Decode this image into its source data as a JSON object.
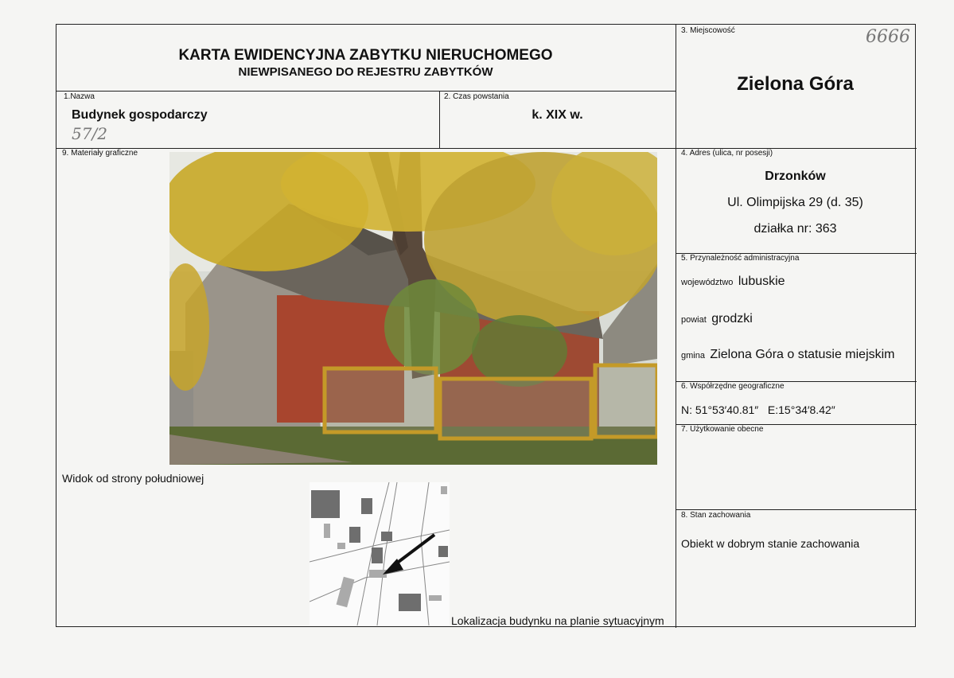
{
  "header": {
    "title_line1": "KARTA EWIDENCYJNA ZABYTKU NIERUCHOMEGO",
    "title_line2": "NIEWPISANEGO DO REJESTRU ZABYTKÓW"
  },
  "handwritten": {
    "card_number": "6666",
    "name_note": "57/2"
  },
  "fields": {
    "nazwa": {
      "label": "1.Nazwa",
      "value": "Budynek gospodarczy"
    },
    "czas": {
      "label": "2. Czas powstania",
      "value": "k. XIX w."
    },
    "miejscowosc": {
      "label": "3. Miejscowość",
      "value": "Zielona Góra"
    },
    "adres": {
      "label": "4. Adres (ulica, nr posesji)",
      "line1": "Drzonków",
      "line2": "Ul. Olimpijska 29 (d. 35)",
      "line3": "działka nr: 363"
    },
    "przynaleznosc": {
      "label": "5. Przynależność administracyjna",
      "woj_label": "województwo",
      "woj_value": "lubuskie",
      "powiat_label": "powiat",
      "powiat_value": "grodzki",
      "gmina_label": "gmina",
      "gmina_value": "Zielona Góra o statusie miejskim"
    },
    "wspolrzedne": {
      "label": "6. Współrzędne geograficzne",
      "value": "N: 51°53′40.81″   E:15°34′8.42″"
    },
    "uzytkowanie": {
      "label": "7. Użytkowanie obecne",
      "value": ""
    },
    "stan": {
      "label": "8. Stan zachowania",
      "value": "Obiekt w dobrym stanie zachowania"
    },
    "materialy": {
      "label": "9. Materiały graficzne",
      "photo_caption": "Widok od strony południowej",
      "map_caption": "Lokalizacja budynku na planie sytuacyjnym"
    }
  },
  "colors": {
    "foliage": "#c9a92a",
    "brick": "#a8452e",
    "wall": "#9a948a",
    "fence": "#c49a28"
  }
}
